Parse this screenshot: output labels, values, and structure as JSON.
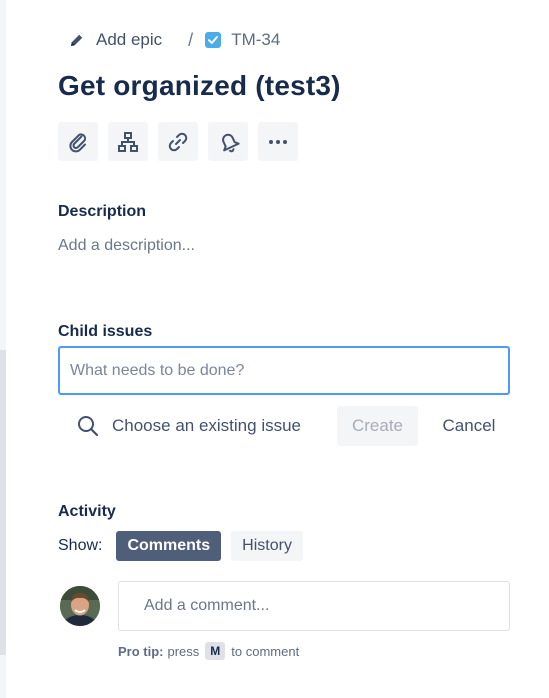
{
  "breadcrumbs": {
    "epic_label": "Add epic",
    "separator": "/",
    "issue_key": "TM-34"
  },
  "issue": {
    "title": "Get organized (test3)"
  },
  "toolbar": {
    "icons": [
      "paperclip-icon",
      "hierarchy-icon",
      "link-icon",
      "bell-icon",
      "more-icon"
    ]
  },
  "description": {
    "label": "Description",
    "placeholder": "Add a description..."
  },
  "child_issues": {
    "label": "Child issues",
    "input_placeholder": "What needs to be done?",
    "input_value": "",
    "choose_existing": "Choose an existing issue",
    "create_label": "Create",
    "cancel_label": "Cancel"
  },
  "activity": {
    "label": "Activity",
    "show_label": "Show:",
    "tabs": [
      {
        "label": "Comments",
        "active": true
      },
      {
        "label": "History",
        "active": false
      }
    ],
    "comment_placeholder": "Add a comment...",
    "pro_tip_bold": "Pro tip:",
    "pro_tip_press": "press",
    "pro_tip_key": "M",
    "pro_tip_suffix": "to comment"
  },
  "colors": {
    "accent": "#4c9aff",
    "active_tab": "#505f79",
    "checkbox": "#4bade8",
    "text_primary": "#172b4d",
    "text_muted": "#6b778c"
  }
}
